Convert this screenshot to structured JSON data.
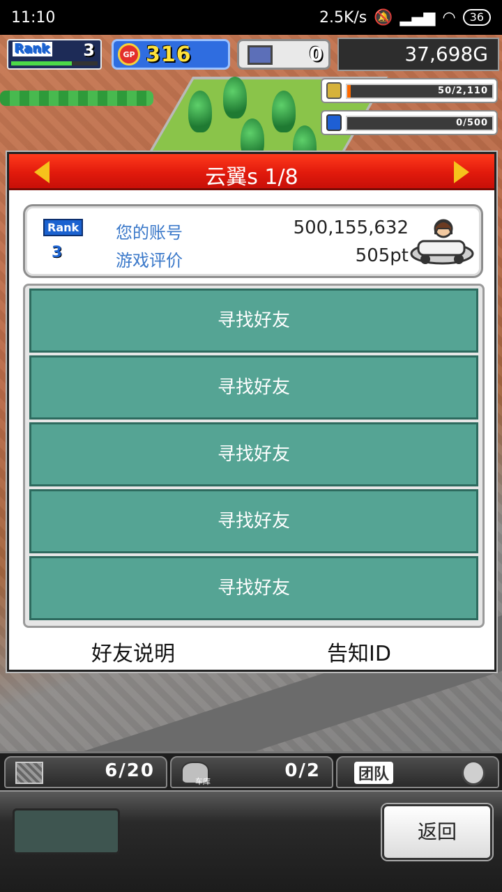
{
  "status_bar": {
    "time": "11:10",
    "network_speed": "2.5K/s",
    "battery": "36"
  },
  "hud": {
    "rank_label": "Rank",
    "rank_value": "3",
    "rank_progress": 0.7,
    "gp_icon_label": "GP",
    "gp_value": "316",
    "pc_value": "0",
    "money": "37,698G",
    "resource_1": {
      "text": "50/2,110",
      "fill": 0.024
    },
    "resource_2": {
      "text": "0/500",
      "fill": 0
    }
  },
  "dialog": {
    "title": "云翼s 1/8",
    "info": {
      "rank_label": "Rank",
      "rank_value": "3",
      "account_label": "您的账号",
      "account_value": "500,155,632",
      "rating_label": "游戏评价",
      "rating_value": "505pt"
    },
    "slots": [
      "寻找好友",
      "寻找好友",
      "寻找好友",
      "寻找好友",
      "寻找好友"
    ],
    "friend_help": "好友说明",
    "notify_id": "告知ID"
  },
  "bottom": {
    "tab_1_count": "6/20",
    "tab_2_caption": "车库",
    "tab_2_count": "0/2",
    "team_label": "团队",
    "back_label": "返回"
  },
  "colors": {
    "header_red": "#e11a0c",
    "slot_teal": "#55a494",
    "gp_blue": "#2f6de0",
    "label_blue": "#3a78c9"
  }
}
